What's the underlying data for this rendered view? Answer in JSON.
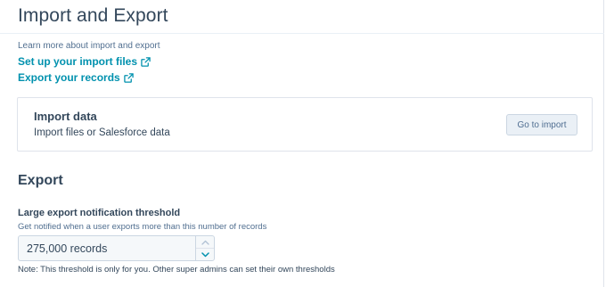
{
  "header": {
    "title": "Import and Export"
  },
  "resources": {
    "learn_more": "Learn more about import and export",
    "links": [
      {
        "label": "Set up your import files",
        "icon": "external-link-icon"
      },
      {
        "label": "Export your records",
        "icon": "external-link-icon"
      }
    ]
  },
  "import_card": {
    "title": "Import data",
    "subtitle": "Import files or Salesforce data",
    "button_label": "Go to import"
  },
  "export": {
    "title": "Export",
    "threshold": {
      "label": "Large export notification threshold",
      "help": "Get notified when a user exports more than this number of records",
      "value": "275,000 records",
      "note": "Note: This threshold is only for you. Other super admins can set their own thresholds"
    }
  },
  "colors": {
    "link": "#0091ae",
    "text": "#33475b",
    "muted": "#516f90",
    "border": "#dfe3eb",
    "button_bg": "#eaf0f6"
  }
}
